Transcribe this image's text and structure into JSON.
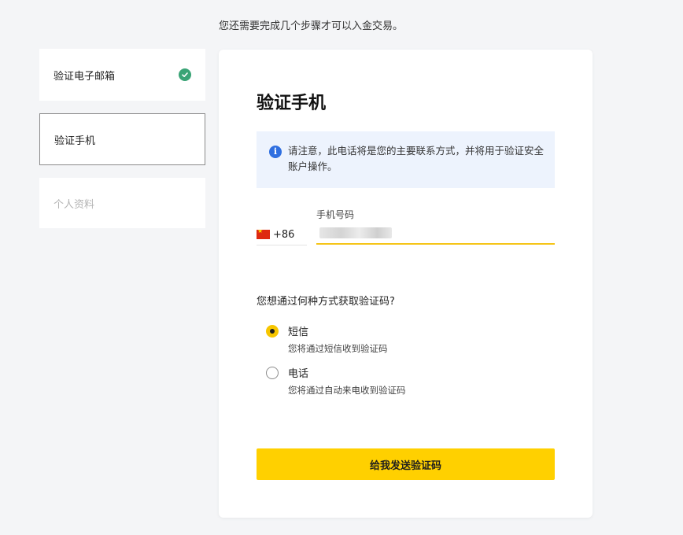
{
  "header": {
    "note": "您还需要完成几个步骤才可以入金交易。"
  },
  "steps": [
    {
      "label": "验证电子邮箱",
      "state": "done"
    },
    {
      "label": "验证手机",
      "state": "active"
    },
    {
      "label": "个人资料",
      "state": "pending"
    }
  ],
  "card": {
    "title": "验证手机",
    "notice": "请注意，此电话将是您的主要联系方式，并将用于验证安全账户操作。",
    "country_code": "+86",
    "flag": "china-flag-icon",
    "phone_label": "手机号码",
    "question": "您想通过何种方式获取验证码?",
    "options": [
      {
        "title": "短信",
        "desc": "您将通过短信收到验证码",
        "selected": true
      },
      {
        "title": "电话",
        "desc": "您将通过自动来电收到验证码",
        "selected": false
      }
    ],
    "submit_label": "给我发送验证码"
  },
  "colors": {
    "accent": "#ffd000",
    "check": "#3aa476",
    "info": "#2f6fe0",
    "notice_bg": "#edf3fd"
  }
}
